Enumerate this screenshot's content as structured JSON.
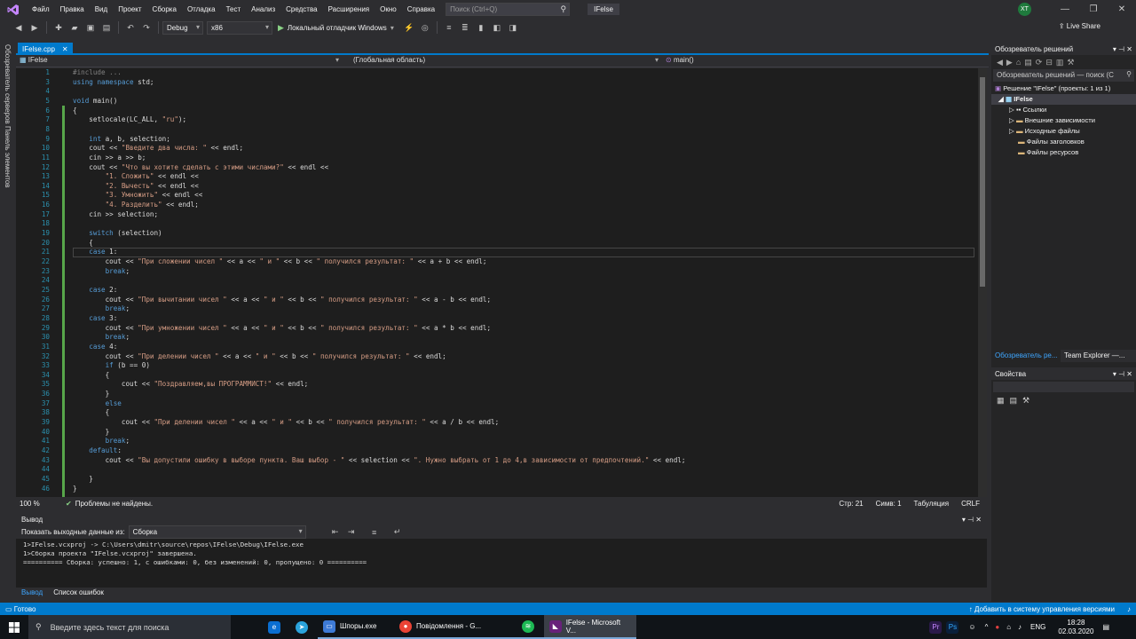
{
  "menubar": {
    "items": [
      "Файл",
      "Правка",
      "Вид",
      "Проект",
      "Сборка",
      "Отладка",
      "Тест",
      "Анализ",
      "Средства",
      "Расширения",
      "Окно",
      "Справка"
    ],
    "search_placeholder": "Поиск (Ctrl+Q)",
    "solution_name": "IFelse",
    "avatar": "XT"
  },
  "toolbar": {
    "config": "Debug",
    "platform": "x86",
    "run_label": "Локальный отладчик Windows",
    "liveshare": "Live Share"
  },
  "left_rail": [
    "Обозреватель серверов",
    "Панель элементов"
  ],
  "doc_tab": {
    "label": "IFelse.cpp",
    "close": "✕"
  },
  "nav": {
    "project": "IFelse",
    "scope": "(Глобальная область)",
    "member": "main()"
  },
  "code": [
    {
      "n": "1",
      "t": "#include ..."
    },
    {
      "n": "3",
      "t": "using namespace std;"
    },
    {
      "n": "4",
      "t": ""
    },
    {
      "n": "5",
      "t": "void main()"
    },
    {
      "n": "6",
      "t": "{"
    },
    {
      "n": "7",
      "t": "    setlocale(LC_ALL, \"ru\");"
    },
    {
      "n": "8",
      "t": ""
    },
    {
      "n": "9",
      "t": "    int a, b, selection;"
    },
    {
      "n": "10",
      "t": "    cout << \"Введите два числа: \" << endl;"
    },
    {
      "n": "11",
      "t": "    cin >> a >> b;"
    },
    {
      "n": "12",
      "t": "    cout << \"Что вы хотите сделать с этими числами?\" << endl <<"
    },
    {
      "n": "13",
      "t": "        \"1. Сложить\" << endl <<"
    },
    {
      "n": "14",
      "t": "        \"2. Вычесть\" << endl <<"
    },
    {
      "n": "15",
      "t": "        \"3. Умножить\" << endl <<"
    },
    {
      "n": "16",
      "t": "        \"4. Разделить\" << endl;"
    },
    {
      "n": "17",
      "t": "    cin >> selection;"
    },
    {
      "n": "18",
      "t": ""
    },
    {
      "n": "19",
      "t": "    switch (selection)"
    },
    {
      "n": "20",
      "t": "    {"
    },
    {
      "n": "21",
      "t": "    case 1:"
    },
    {
      "n": "22",
      "t": "        cout << \"При сложении чисел \" << a << \" и \" << b << \" получился результат: \" << a + b << endl;"
    },
    {
      "n": "23",
      "t": "        break;"
    },
    {
      "n": "24",
      "t": ""
    },
    {
      "n": "25",
      "t": "    case 2:"
    },
    {
      "n": "26",
      "t": "        cout << \"При вычитании чисел \" << a << \" и \" << b << \" получился результат: \" << a - b << endl;"
    },
    {
      "n": "27",
      "t": "        break;"
    },
    {
      "n": "28",
      "t": "    case 3:"
    },
    {
      "n": "29",
      "t": "        cout << \"При умножении чисел \" << a << \" и \" << b << \" получился результат: \" << a * b << endl;"
    },
    {
      "n": "30",
      "t": "        break;"
    },
    {
      "n": "31",
      "t": "    case 4:"
    },
    {
      "n": "32",
      "t": "        cout << \"При делении чисел \" << a << \" и \" << b << \" получился результат: \" << endl;"
    },
    {
      "n": "33",
      "t": "        if (b == 0)"
    },
    {
      "n": "34",
      "t": "        {"
    },
    {
      "n": "35",
      "t": "            cout << \"Поздравляем,вы ПРОГРАММИСТ!\" << endl;"
    },
    {
      "n": "36",
      "t": "        }"
    },
    {
      "n": "37",
      "t": "        else"
    },
    {
      "n": "38",
      "t": "        {"
    },
    {
      "n": "39",
      "t": "            cout << \"При делении чисел \" << a << \" и \" << b << \" получился результат: \" << a / b << endl;"
    },
    {
      "n": "40",
      "t": "        }"
    },
    {
      "n": "41",
      "t": "        break;"
    },
    {
      "n": "42",
      "t": "    default:"
    },
    {
      "n": "43",
      "t": "        cout << \"Вы допустили ошибку в выборе пункта. Ваш выбор - \" << selection << \". Нужно выбрать от 1 до 4,в зависимости от предпочтений.\" << endl;"
    },
    {
      "n": "44",
      "t": ""
    },
    {
      "n": "45",
      "t": "    }"
    },
    {
      "n": "46",
      "t": "}"
    }
  ],
  "editor_status": {
    "zoom": "100 %",
    "issues": "Проблемы не найдены.",
    "line": "Стр: 21",
    "col": "Симв: 1",
    "tabs": "Табуляция",
    "eol": "CRLF"
  },
  "output": {
    "title": "Вывод",
    "show_label": "Показать выходные данные из:",
    "source": "Сборка",
    "lines": [
      "1>IFelse.vcxproj -> C:\\Users\\dmitr\\source\\repos\\IFelse\\Debug\\IFelse.exe",
      "1>Сборка проекта \"IFelse.vcxproj\" завершена.",
      "========== Сборка: успешно: 1, с ошибками: 0, без изменений: 0, пропущено: 0 =========="
    ]
  },
  "bottom_tabs": [
    "Вывод",
    "Список ошибок"
  ],
  "solution_explorer": {
    "title": "Обозреватель решений",
    "search": "Обозреватель решений — поиск (C",
    "solution": "Решение \"IFelse\" (проекты: 1 из 1)",
    "project": "IFelse",
    "nodes": [
      "Ссылки",
      "Внешние зависимости",
      "Исходные файлы",
      "Файлы заголовков",
      "Файлы ресурсов"
    ],
    "tab1": "Обозреватель ре...",
    "tab2": "Team Explorer —..."
  },
  "properties": {
    "title": "Свойства"
  },
  "statusbar": {
    "left": "Готово",
    "right": "Добавить в систему управления версиями"
  },
  "taskbar": {
    "search": "Введите здесь текст для поиска",
    "apps": [
      "Шпоры.exe",
      "Повідомлення - G...",
      "IFelse - Microsoft V..."
    ],
    "lang": "ENG",
    "time": "18:28",
    "date": "02.03.2020"
  },
  "colors": {
    "accent": "#007acc",
    "editor_bg": "#1e1e1e",
    "keyword": "#569cd6",
    "string": "#d69d85"
  }
}
